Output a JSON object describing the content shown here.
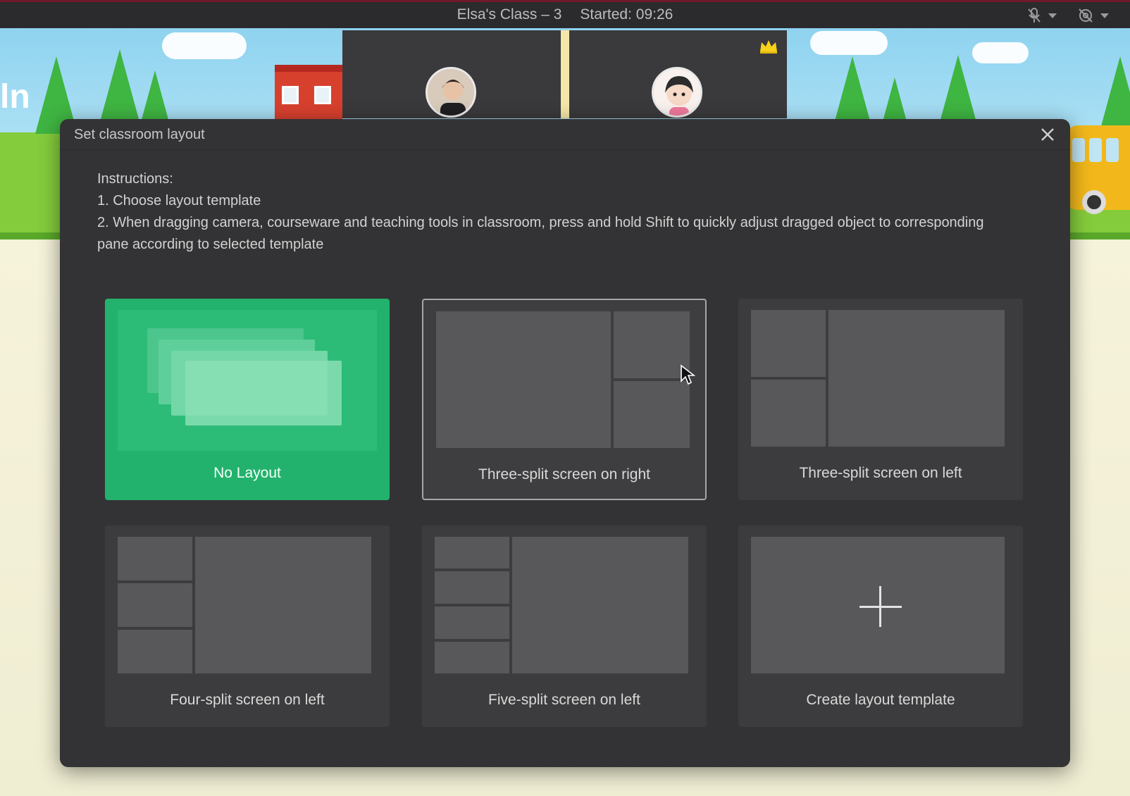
{
  "topbar": {
    "class_name": "Elsa's Class – 3",
    "started": "Started: 09:26",
    "mic_icon": "mic-muted-icon",
    "camera_icon": "camera-off-icon"
  },
  "scene": {
    "partial_text": "ln"
  },
  "video_tiles": [
    {
      "avatar_icon": "teacher-avatar-icon"
    },
    {
      "avatar_icon": "student-avatar-icon",
      "badge_icon": "crown-icon"
    }
  ],
  "modal": {
    "title": "Set classroom layout",
    "close_icon": "close-icon",
    "instructions": {
      "heading": "Instructions:",
      "step1": "1. Choose layout template",
      "step2": "2. When dragging camera, courseware and teaching tools in classroom, press and hold Shift to quickly adjust dragged object to corresponding pane according to selected template"
    },
    "templates": [
      {
        "label": "No Layout",
        "state": "selected"
      },
      {
        "label": "Three-split screen on right",
        "state": "hover"
      },
      {
        "label": "Three-split screen on left",
        "state": "normal"
      },
      {
        "label": "Four-split screen on left",
        "state": "normal"
      },
      {
        "label": "Five-split screen on left",
        "state": "normal"
      },
      {
        "label": "Create layout template",
        "state": "normal",
        "icon": "plus-icon"
      }
    ]
  },
  "colors": {
    "selected": "#23b26d",
    "modal_bg": "#333335",
    "card_bg": "#3c3c3e",
    "pane": "#58585a"
  }
}
